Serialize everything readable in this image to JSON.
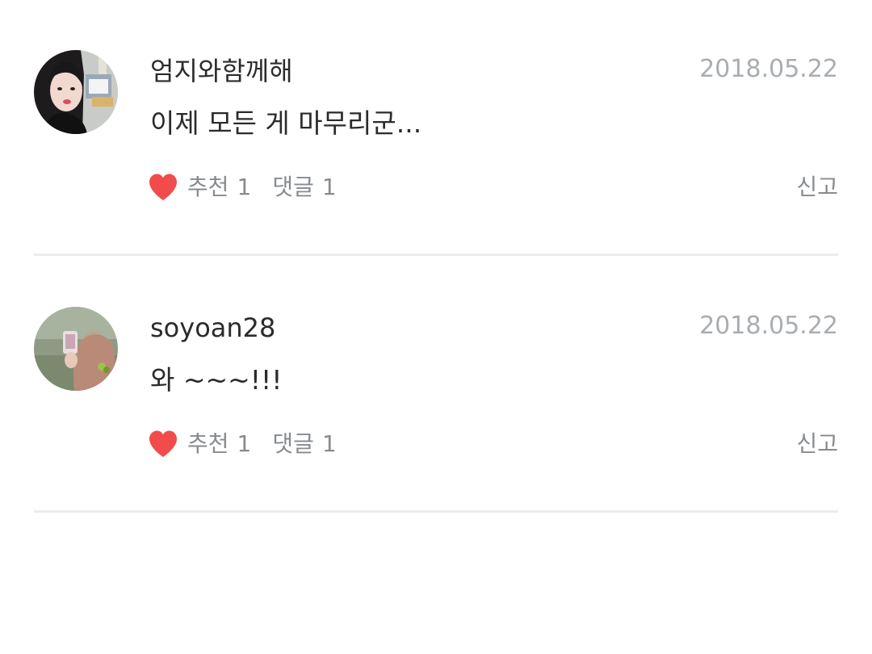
{
  "colors": {
    "heart": "#f24b4b",
    "text": "#2b2b2b",
    "muted": "#878b90",
    "date": "#a9adb2",
    "divider": "#ececec"
  },
  "comments": [
    {
      "username": "엄지와함께해",
      "date": "2018.05.22",
      "text": "이제 모든 게 마무리군...",
      "like_icon": "heart-icon",
      "like_label": "추천",
      "like_count": "1",
      "reply_label": "댓글",
      "reply_count": "1",
      "report_label": "신고"
    },
    {
      "username": "soyoan28",
      "date": "2018.05.22",
      "text": "와 ~~~!!!",
      "like_icon": "heart-icon",
      "like_label": "추천",
      "like_count": "1",
      "reply_label": "댓글",
      "reply_count": "1",
      "report_label": "신고"
    }
  ]
}
